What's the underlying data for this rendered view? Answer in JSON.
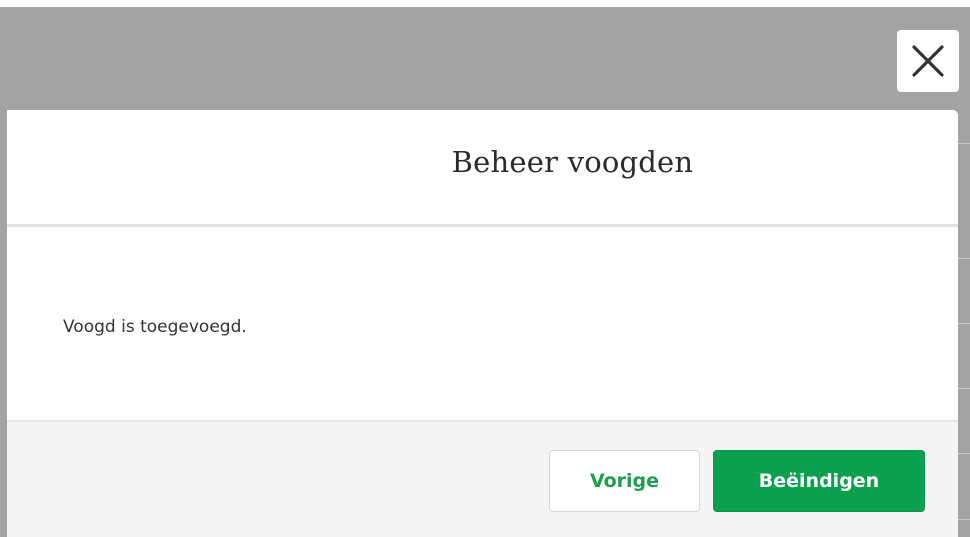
{
  "dialog": {
    "title": "Beheer voogden",
    "message": "Voogd is toegevoegd.",
    "close_icon": "close-icon"
  },
  "footer": {
    "prev_label": "Vorige",
    "finish_label": "Beëindigen"
  },
  "colors": {
    "overlay": "#a3a3a3",
    "primary": "#0aa04e",
    "secondary_text": "#1e9f4c",
    "footer_bg": "#f5f5f5"
  }
}
